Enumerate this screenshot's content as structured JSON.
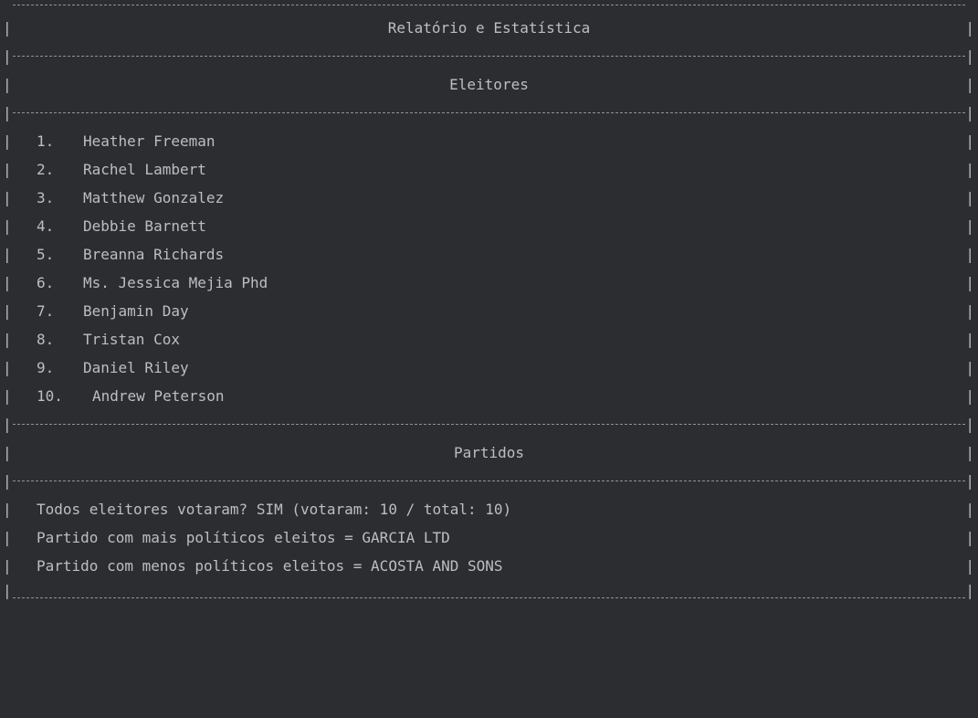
{
  "report": {
    "title": "Relatório e Estatística",
    "voters_heading": "Eleitores",
    "voters": [
      {
        "num": "1.",
        "name": "Heather Freeman"
      },
      {
        "num": "2.",
        "name": "Rachel Lambert"
      },
      {
        "num": "3.",
        "name": "Matthew Gonzalez"
      },
      {
        "num": "4.",
        "name": "Debbie Barnett"
      },
      {
        "num": "5.",
        "name": "Breanna Richards"
      },
      {
        "num": "6.",
        "name": "Ms. Jessica Mejia Phd"
      },
      {
        "num": "7.",
        "name": "Benjamin Day"
      },
      {
        "num": "8.",
        "name": "Tristan Cox"
      },
      {
        "num": "9.",
        "name": "Daniel Riley"
      },
      {
        "num": "10.",
        "name": "Andrew Peterson"
      }
    ],
    "parties_heading": "Partidos",
    "stats": [
      "Todos eleitores votaram? SIM (votaram: 10 / total: 10)",
      "Partido com mais políticos eleitos = GARCIA LTD",
      "Partido com menos políticos eleitos = ACOSTA AND SONS"
    ],
    "border_char": "|"
  }
}
